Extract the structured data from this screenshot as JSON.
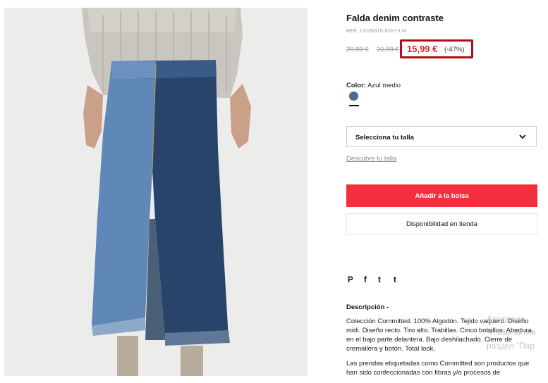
{
  "product": {
    "title": "Falda denim contraste",
    "ref": "REF. 17036315-IGGY-LM",
    "old_price_1": "29,99 €",
    "old_price_2": "20,99 €",
    "price": "15,99 €",
    "discount": "(-47%)",
    "color_label": "Color:",
    "color_value": "Azul medio",
    "swatch_color": "#4d6992",
    "size_select_label": "Selecciona tu talla",
    "size_guide_link": "Descubre tu talla",
    "add_to_bag": "Añadir a la bolsa",
    "store_availability": "Disponibilidad en tienda",
    "highlight_color": "#b00d14",
    "accent_color": "#f32f3d"
  },
  "social": [
    {
      "icon": "pinterest-icon",
      "glyph": "P"
    },
    {
      "icon": "facebook-icon",
      "glyph": "f"
    },
    {
      "icon": "twitter-icon",
      "glyph": "t"
    },
    {
      "icon": "tumblr-icon",
      "glyph": "t"
    }
  ],
  "description": {
    "title": "Descripción -",
    "paragraph_1": "Colección Committed. 100% Algodón. Tejido vaquero. Diseño midi. Diseño recto. Tiro alto. Trabillas. Cinco bolsillos. Abertura en el bajo parte delantera. Bajo deshilachado. Cierre de cremallera y botón. Total look.",
    "paragraph_2": "Las prendas etiquetadas como Committed son productos que han sido confeccionadas con fibras y/o procesos de"
  },
  "watermark": {
    "line_1": "Активаци",
    "line_2": "Чтобы актив",
    "line_3": "раздел “Пар"
  }
}
